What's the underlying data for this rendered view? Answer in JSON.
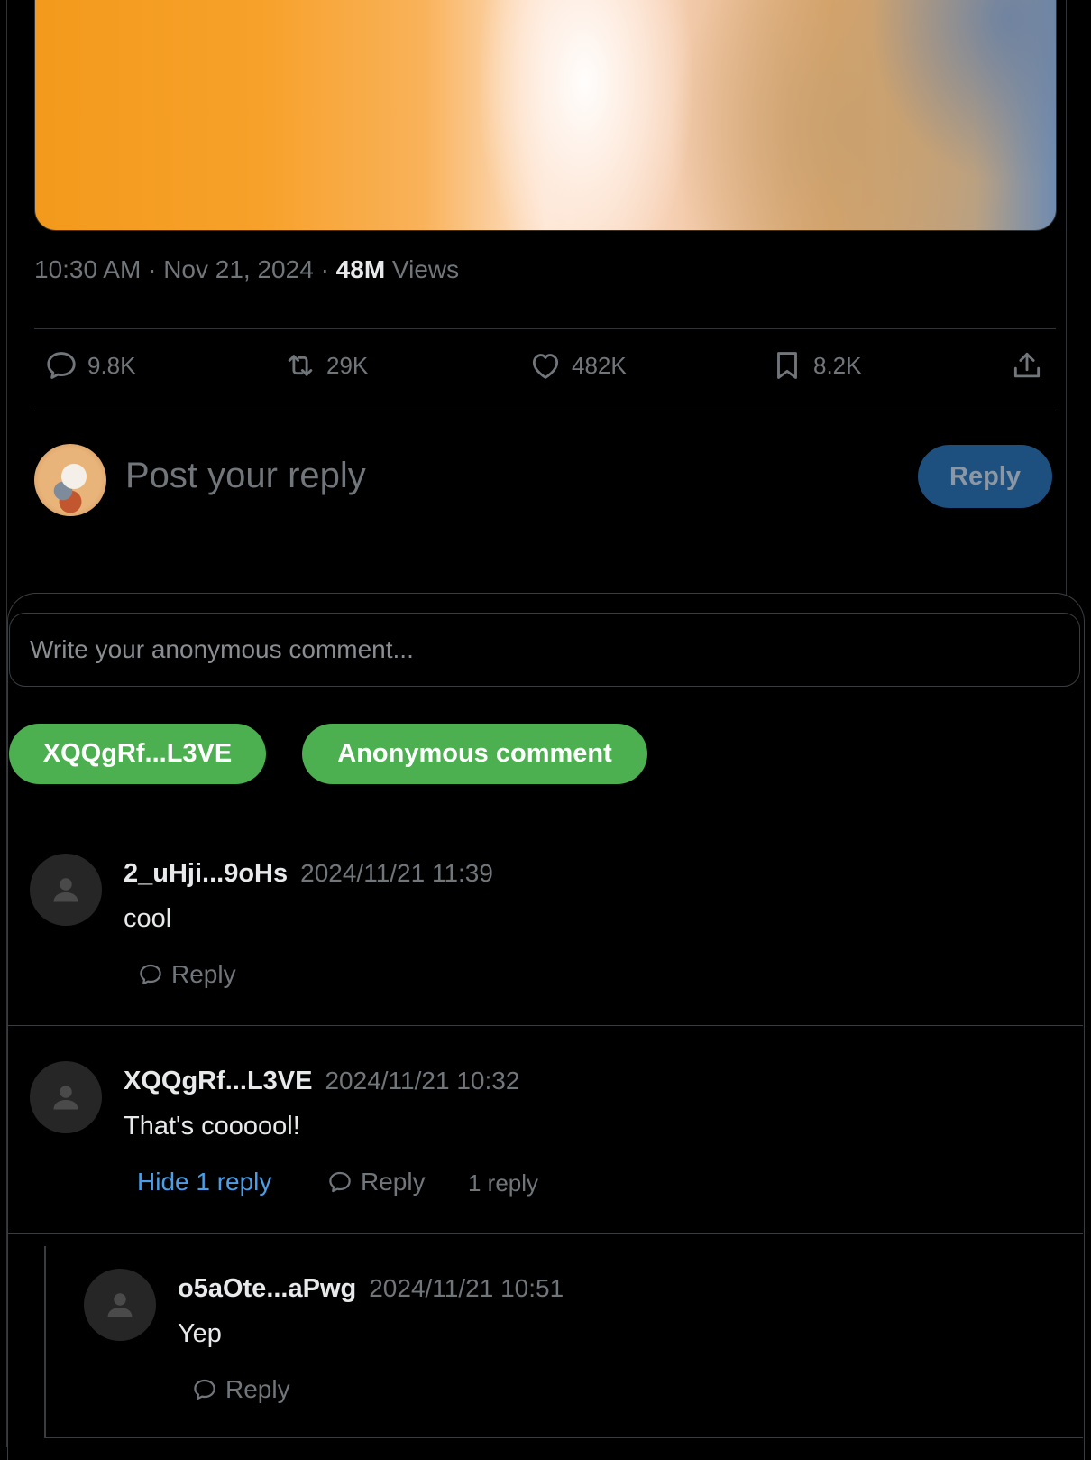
{
  "post": {
    "time": "10:30 AM",
    "date": "Nov 21, 2024",
    "views_count": "48M",
    "views_label": "Views"
  },
  "actions": {
    "replies": "9.8K",
    "reposts": "29K",
    "likes": "482K",
    "bookmarks": "8.2K"
  },
  "composer": {
    "placeholder": "Post your reply",
    "button": "Reply"
  },
  "anon": {
    "placeholder": "Write your anonymous comment...",
    "user_pill": "XQQgRf...L3VE",
    "submit_pill": "Anonymous comment"
  },
  "comments": [
    {
      "name": "2_uHji...9oHs",
      "time": "2024/11/21 11:39",
      "text": "cool",
      "reply_label": "Reply"
    },
    {
      "name": "XQQgRf...L3VE",
      "time": "2024/11/21 10:32",
      "text": "That's coooool!",
      "hide_label": "Hide 1 reply",
      "reply_label": "Reply",
      "count_label": "1 reply"
    },
    {
      "name": "o5aOte...aPwg",
      "time": "2024/11/21 10:51",
      "text": "Yep",
      "reply_label": "Reply"
    }
  ]
}
